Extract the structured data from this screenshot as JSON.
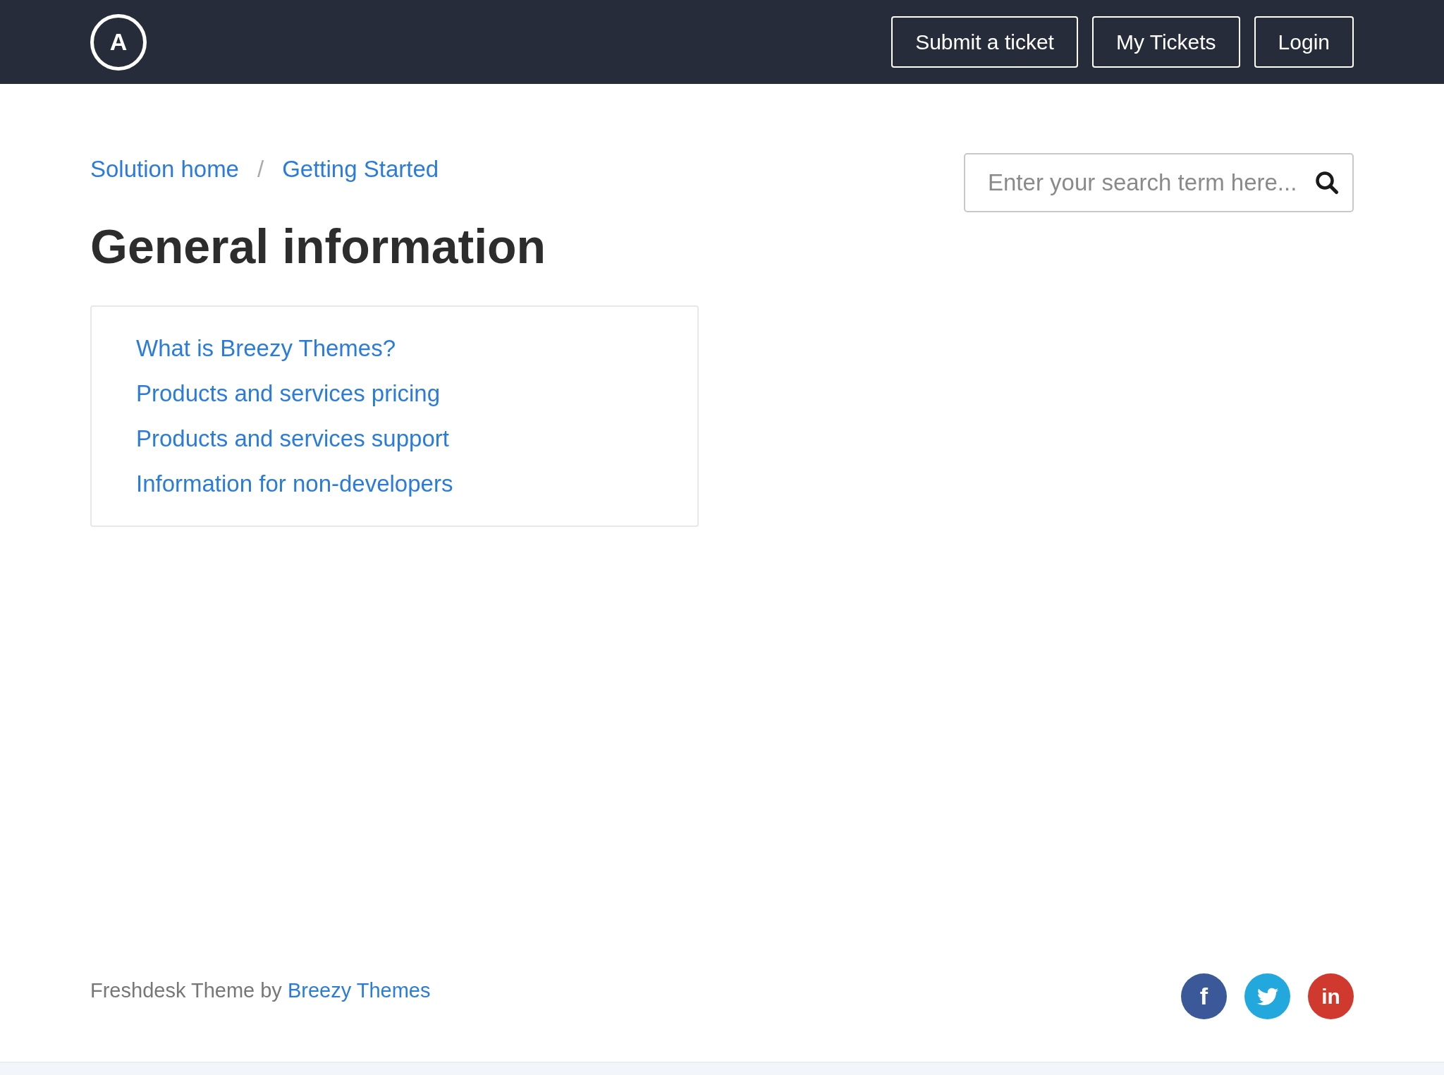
{
  "header": {
    "logo": "A",
    "buttons": [
      "Submit a ticket",
      "My Tickets",
      "Login"
    ]
  },
  "breadcrumb": [
    "Solution home",
    "Getting Started"
  ],
  "breadcrumb_separator": "/",
  "title": "General information",
  "search": {
    "placeholder": "Enter your search term here..."
  },
  "articles": [
    "What is Breezy Themes?",
    "Products and services pricing",
    "Products and services support",
    "Information for non-developers"
  ],
  "footer": {
    "text": "Freshdesk Theme by",
    "link": "Breezy Themes"
  },
  "social": [
    {
      "kind": "facebook",
      "glyph": "f",
      "color": "#3b5998"
    },
    {
      "kind": "twitter",
      "color": "#22a8dd"
    },
    {
      "kind": "linkedin",
      "glyph": "in",
      "color": "#d0392e"
    }
  ]
}
